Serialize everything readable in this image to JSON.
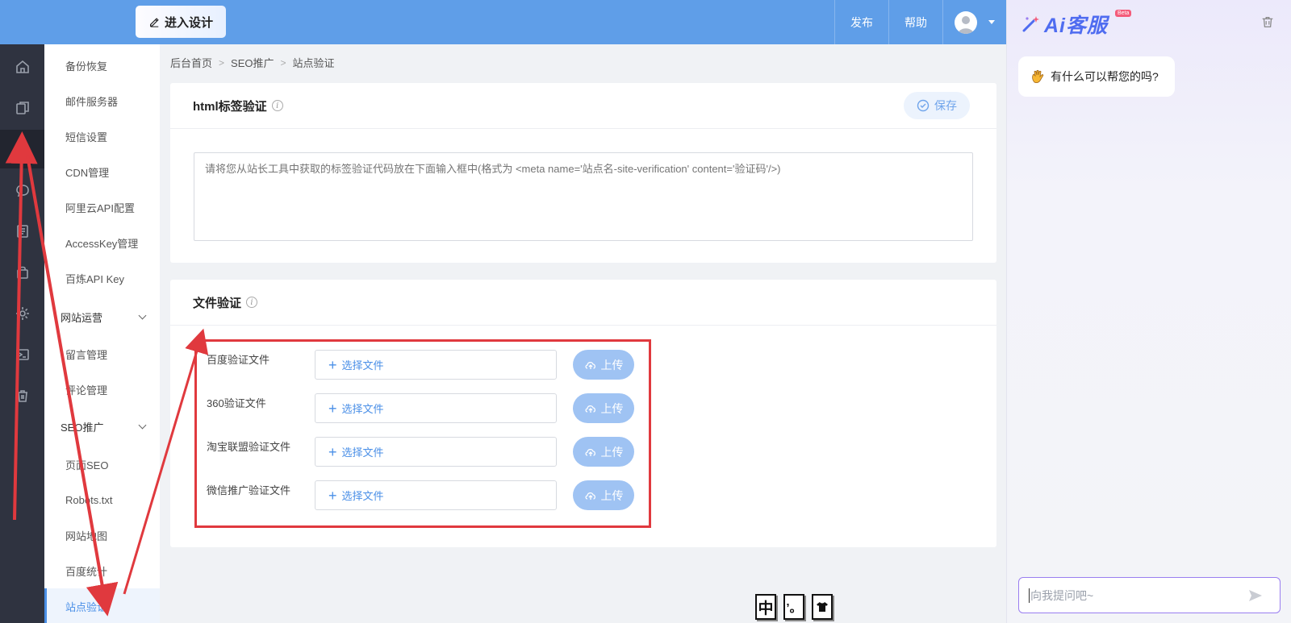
{
  "header": {
    "enter_design": "进入设计",
    "publish": "发布",
    "help": "帮助"
  },
  "sidebar": {
    "items": [
      {
        "label": "备份恢复"
      },
      {
        "label": "邮件服务器"
      },
      {
        "label": "短信设置"
      },
      {
        "label": "CDN管理"
      },
      {
        "label": "阿里云API配置"
      },
      {
        "label": "AccessKey管理"
      },
      {
        "label": "百炼API Key"
      }
    ],
    "group_ops": "网站运营",
    "ops_items": [
      {
        "label": "留言管理"
      },
      {
        "label": "评论管理"
      }
    ],
    "group_seo": "SEO推广",
    "seo_items": [
      {
        "label": "页面SEO"
      },
      {
        "label": "Robots.txt"
      },
      {
        "label": "网站地图"
      },
      {
        "label": "百度统计"
      },
      {
        "label": "站点验证"
      }
    ]
  },
  "breadcrumb": [
    "后台首页",
    "SEO推广",
    "站点验证"
  ],
  "html_card": {
    "title": "html标签验证",
    "save_label": "保存",
    "placeholder": "请将您从站长工具中获取的标签验证代码放在下面输入框中(格式为 <meta name='站点名-site-verification' content='验证码'/>)"
  },
  "file_card": {
    "title": "文件验证",
    "choose_label": "选择文件",
    "upload_label": "上传",
    "rows": [
      {
        "label": "百度验证文件"
      },
      {
        "label": "360验证文件"
      },
      {
        "label": "淘宝联盟验证文件"
      },
      {
        "label": "微信推广验证文件"
      }
    ]
  },
  "ai": {
    "brand": "Ai客服",
    "beta": "Beta",
    "greeting": "有什么可以帮您的吗?",
    "input_placeholder": "向我提问吧~"
  },
  "ime": {
    "lang": "中",
    "punct": "’。"
  },
  "colors": {
    "header": "#5f9ee8",
    "accent": "#4a8fe7",
    "highlight_box": "#e0393e",
    "rail": "#2f3340"
  }
}
